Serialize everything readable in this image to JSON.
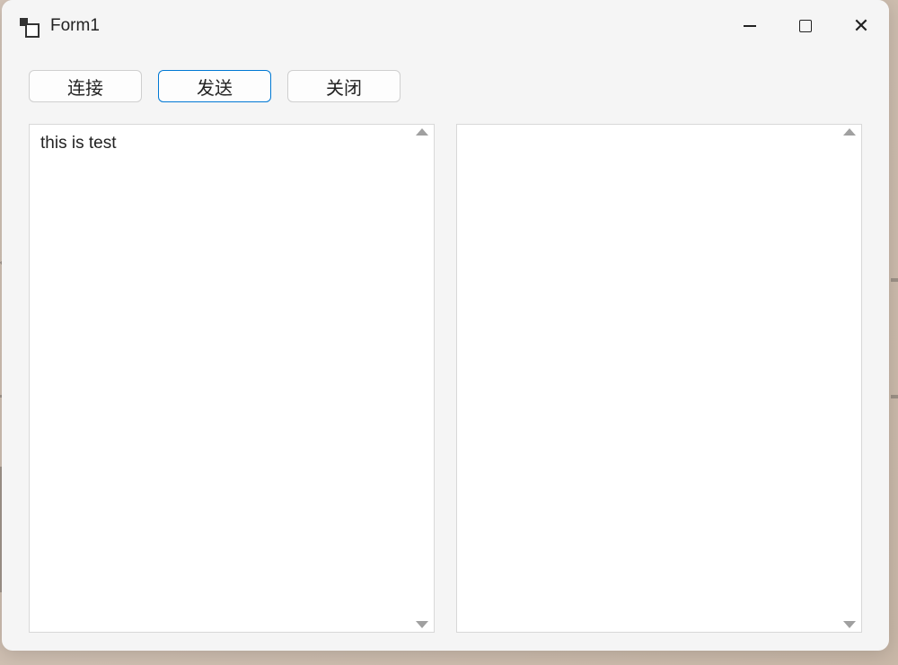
{
  "window": {
    "title": "Form1"
  },
  "buttons": {
    "connect": "连接",
    "send": "发送",
    "close": "关闭"
  },
  "textboxes": {
    "left_value": "this is test",
    "right_value": ""
  }
}
